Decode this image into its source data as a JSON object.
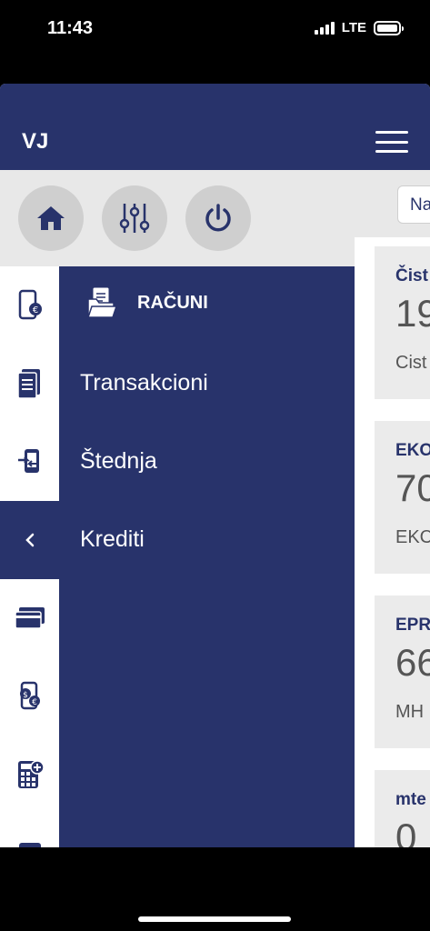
{
  "status": {
    "time": "11:43",
    "network": "LTE"
  },
  "header": {
    "initials": "VJ"
  },
  "toolbar": {
    "buttons": [
      "home-icon",
      "sliders-icon",
      "power-icon"
    ]
  },
  "rail": {
    "icons": [
      "phone-euro-icon",
      "document-icon",
      "phone-transfer-icon",
      "chevron-left-icon",
      "card-icon",
      "phone-money-icon",
      "calculator-icon"
    ],
    "active_index": 3
  },
  "submenu": {
    "title": "RAČUNI",
    "items": [
      "Transakcioni",
      "Štednja",
      "Krediti"
    ]
  },
  "content": {
    "filter_text": "Na",
    "cards": [
      {
        "name": "Čist",
        "amount": "19",
        "sub": "Cist"
      },
      {
        "name": "EKO",
        "amount": "70",
        "sub": "EKC"
      },
      {
        "name": "EPR",
        "amount": "66",
        "sub": "MH"
      },
      {
        "name": "mte",
        "amount": "0",
        "sub": ""
      }
    ]
  },
  "colors": {
    "primary": "#28336b",
    "light_gray": "#e8e8e8",
    "button_gray": "#cfcfcf"
  }
}
